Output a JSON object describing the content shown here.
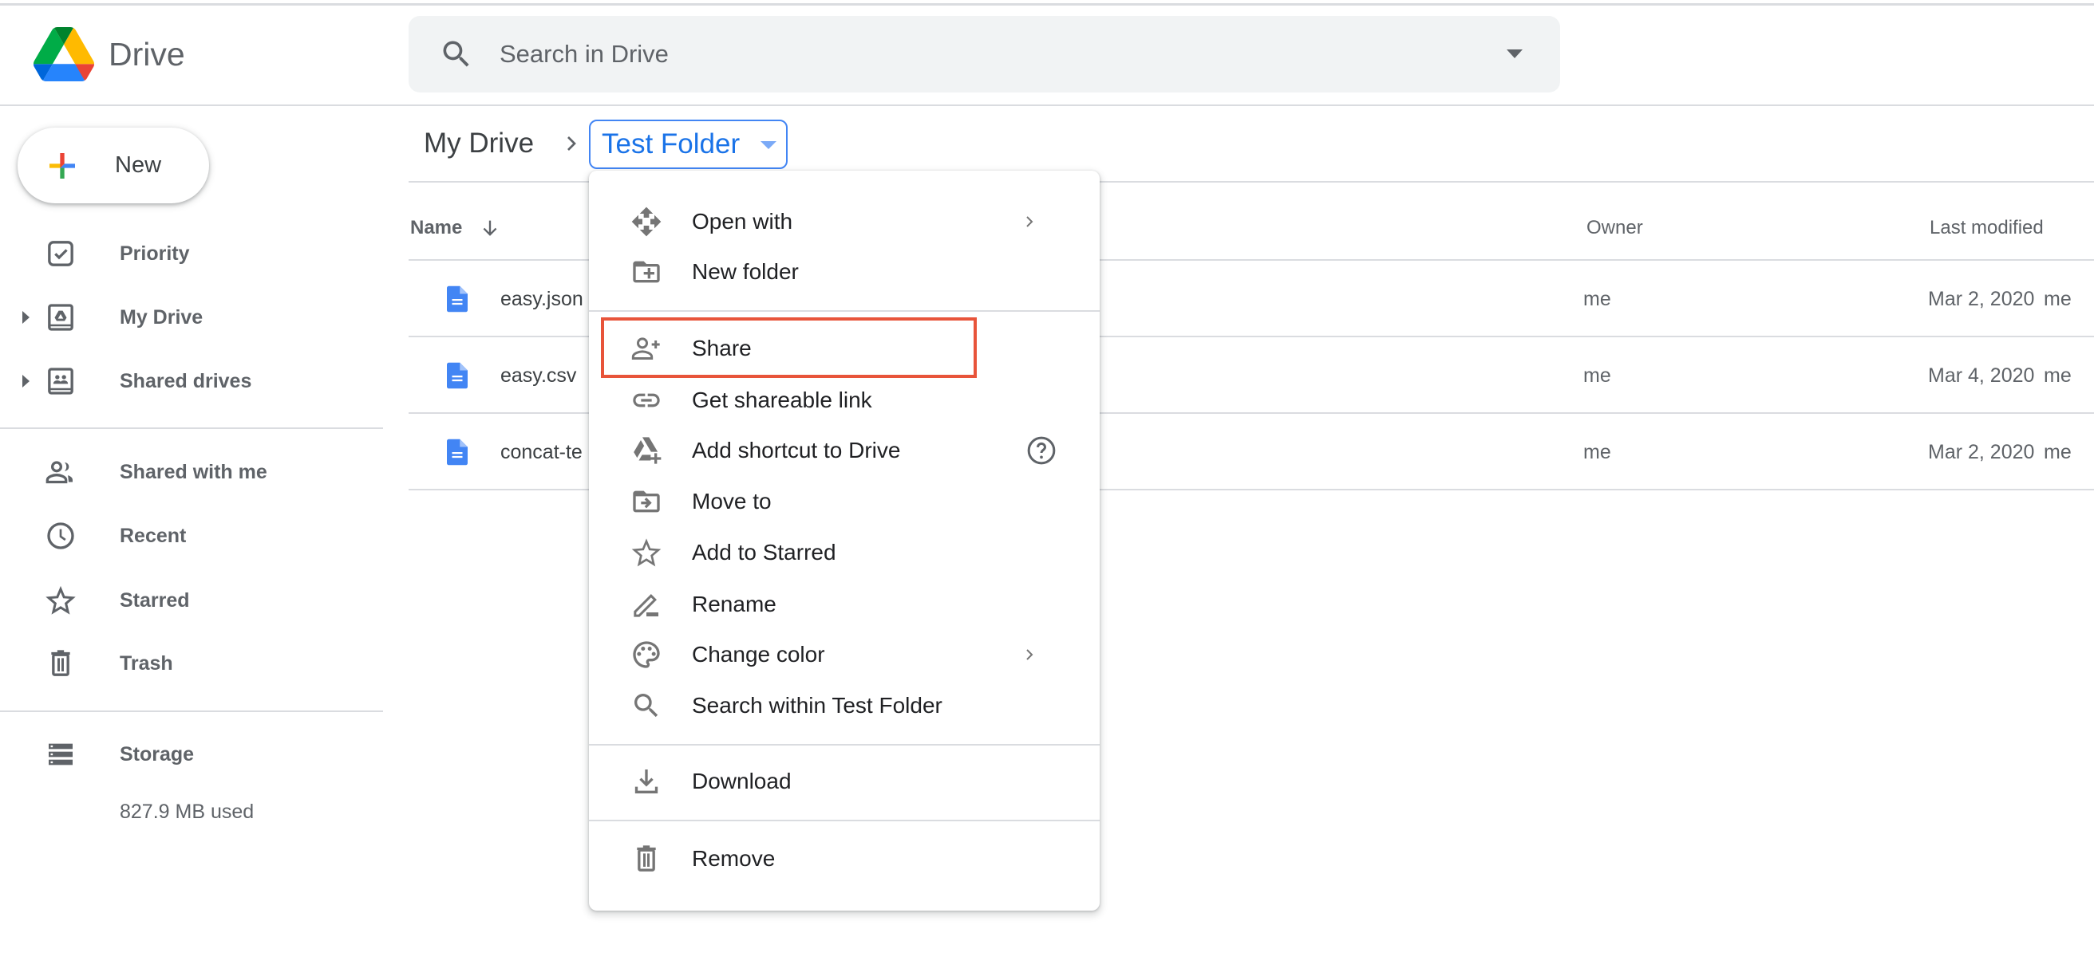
{
  "app": {
    "title": "Drive",
    "brand_colors": {
      "green": "#0f9d58",
      "yellow": "#f4b400",
      "blue": "#4285f4",
      "red": "#db4437"
    }
  },
  "search": {
    "placeholder": "Search in Drive",
    "icon": "search-icon",
    "options_icon": "dropdown-arrow-icon"
  },
  "sidebar": {
    "new_button": {
      "label": "New",
      "icon": "plus-icon"
    },
    "items": [
      {
        "label": "Priority",
        "icon": "priority-checkbox-icon",
        "expandable": false
      },
      {
        "label": "My Drive",
        "icon": "my-drive-icon",
        "expandable": true
      },
      {
        "label": "Shared drives",
        "icon": "shared-drives-icon",
        "expandable": true
      },
      {
        "label": "Shared with me",
        "icon": "people-icon",
        "expandable": false
      },
      {
        "label": "Recent",
        "icon": "clock-icon",
        "expandable": false
      },
      {
        "label": "Starred",
        "icon": "star-icon",
        "expandable": false
      },
      {
        "label": "Trash",
        "icon": "trash-icon",
        "expandable": false
      }
    ],
    "storage": {
      "label": "Storage",
      "icon": "storage-icon",
      "used": "827.9 MB used"
    }
  },
  "breadcrumb": {
    "root": "My Drive",
    "separator_icon": "chevron-right-icon",
    "current": "Test Folder",
    "current_icon": "caret-down-icon",
    "accent_color": "#1a73e8"
  },
  "table": {
    "columns": {
      "name": "Name",
      "owner": "Owner",
      "last_modified": "Last modified"
    },
    "sort": {
      "column": "Name",
      "direction": "descending",
      "icon": "arrow-down-icon"
    },
    "rows": [
      {
        "name": "easy.json",
        "icon": "google-doc-icon",
        "owner": "me",
        "modified_date": "Mar 2, 2020",
        "modified_by": "me"
      },
      {
        "name": "easy.csv",
        "icon": "google-doc-icon",
        "owner": "me",
        "modified_date": "Mar 4, 2020",
        "modified_by": "me"
      },
      {
        "name": "concat-te",
        "icon": "google-doc-icon",
        "owner": "me",
        "modified_date": "Mar 2, 2020",
        "modified_by": "me"
      }
    ]
  },
  "context_menu": {
    "groups": [
      [
        {
          "label": "Open with",
          "icon": "open-with-icon",
          "submenu": true
        },
        {
          "label": "New folder",
          "icon": "new-folder-icon",
          "submenu": false
        }
      ],
      [
        {
          "label": "Share",
          "icon": "person-add-icon",
          "submenu": false,
          "highlighted": true
        },
        {
          "label": "Get shareable link",
          "icon": "link-icon",
          "submenu": false
        },
        {
          "label": "Add shortcut to Drive",
          "icon": "drive-shortcut-icon",
          "submenu": false,
          "help": true
        },
        {
          "label": "Move to",
          "icon": "move-to-folder-icon",
          "submenu": false
        },
        {
          "label": "Add to Starred",
          "icon": "star-icon",
          "submenu": false
        },
        {
          "label": "Rename",
          "icon": "pencil-icon",
          "submenu": false
        },
        {
          "label": "Change color",
          "icon": "palette-icon",
          "submenu": true
        },
        {
          "label": "Search within Test Folder",
          "icon": "search-icon",
          "submenu": false
        }
      ],
      [
        {
          "label": "Download",
          "icon": "download-icon",
          "submenu": false
        }
      ],
      [
        {
          "label": "Remove",
          "icon": "trash-icon",
          "submenu": false
        }
      ]
    ],
    "highlight_color": "#e8543a"
  }
}
